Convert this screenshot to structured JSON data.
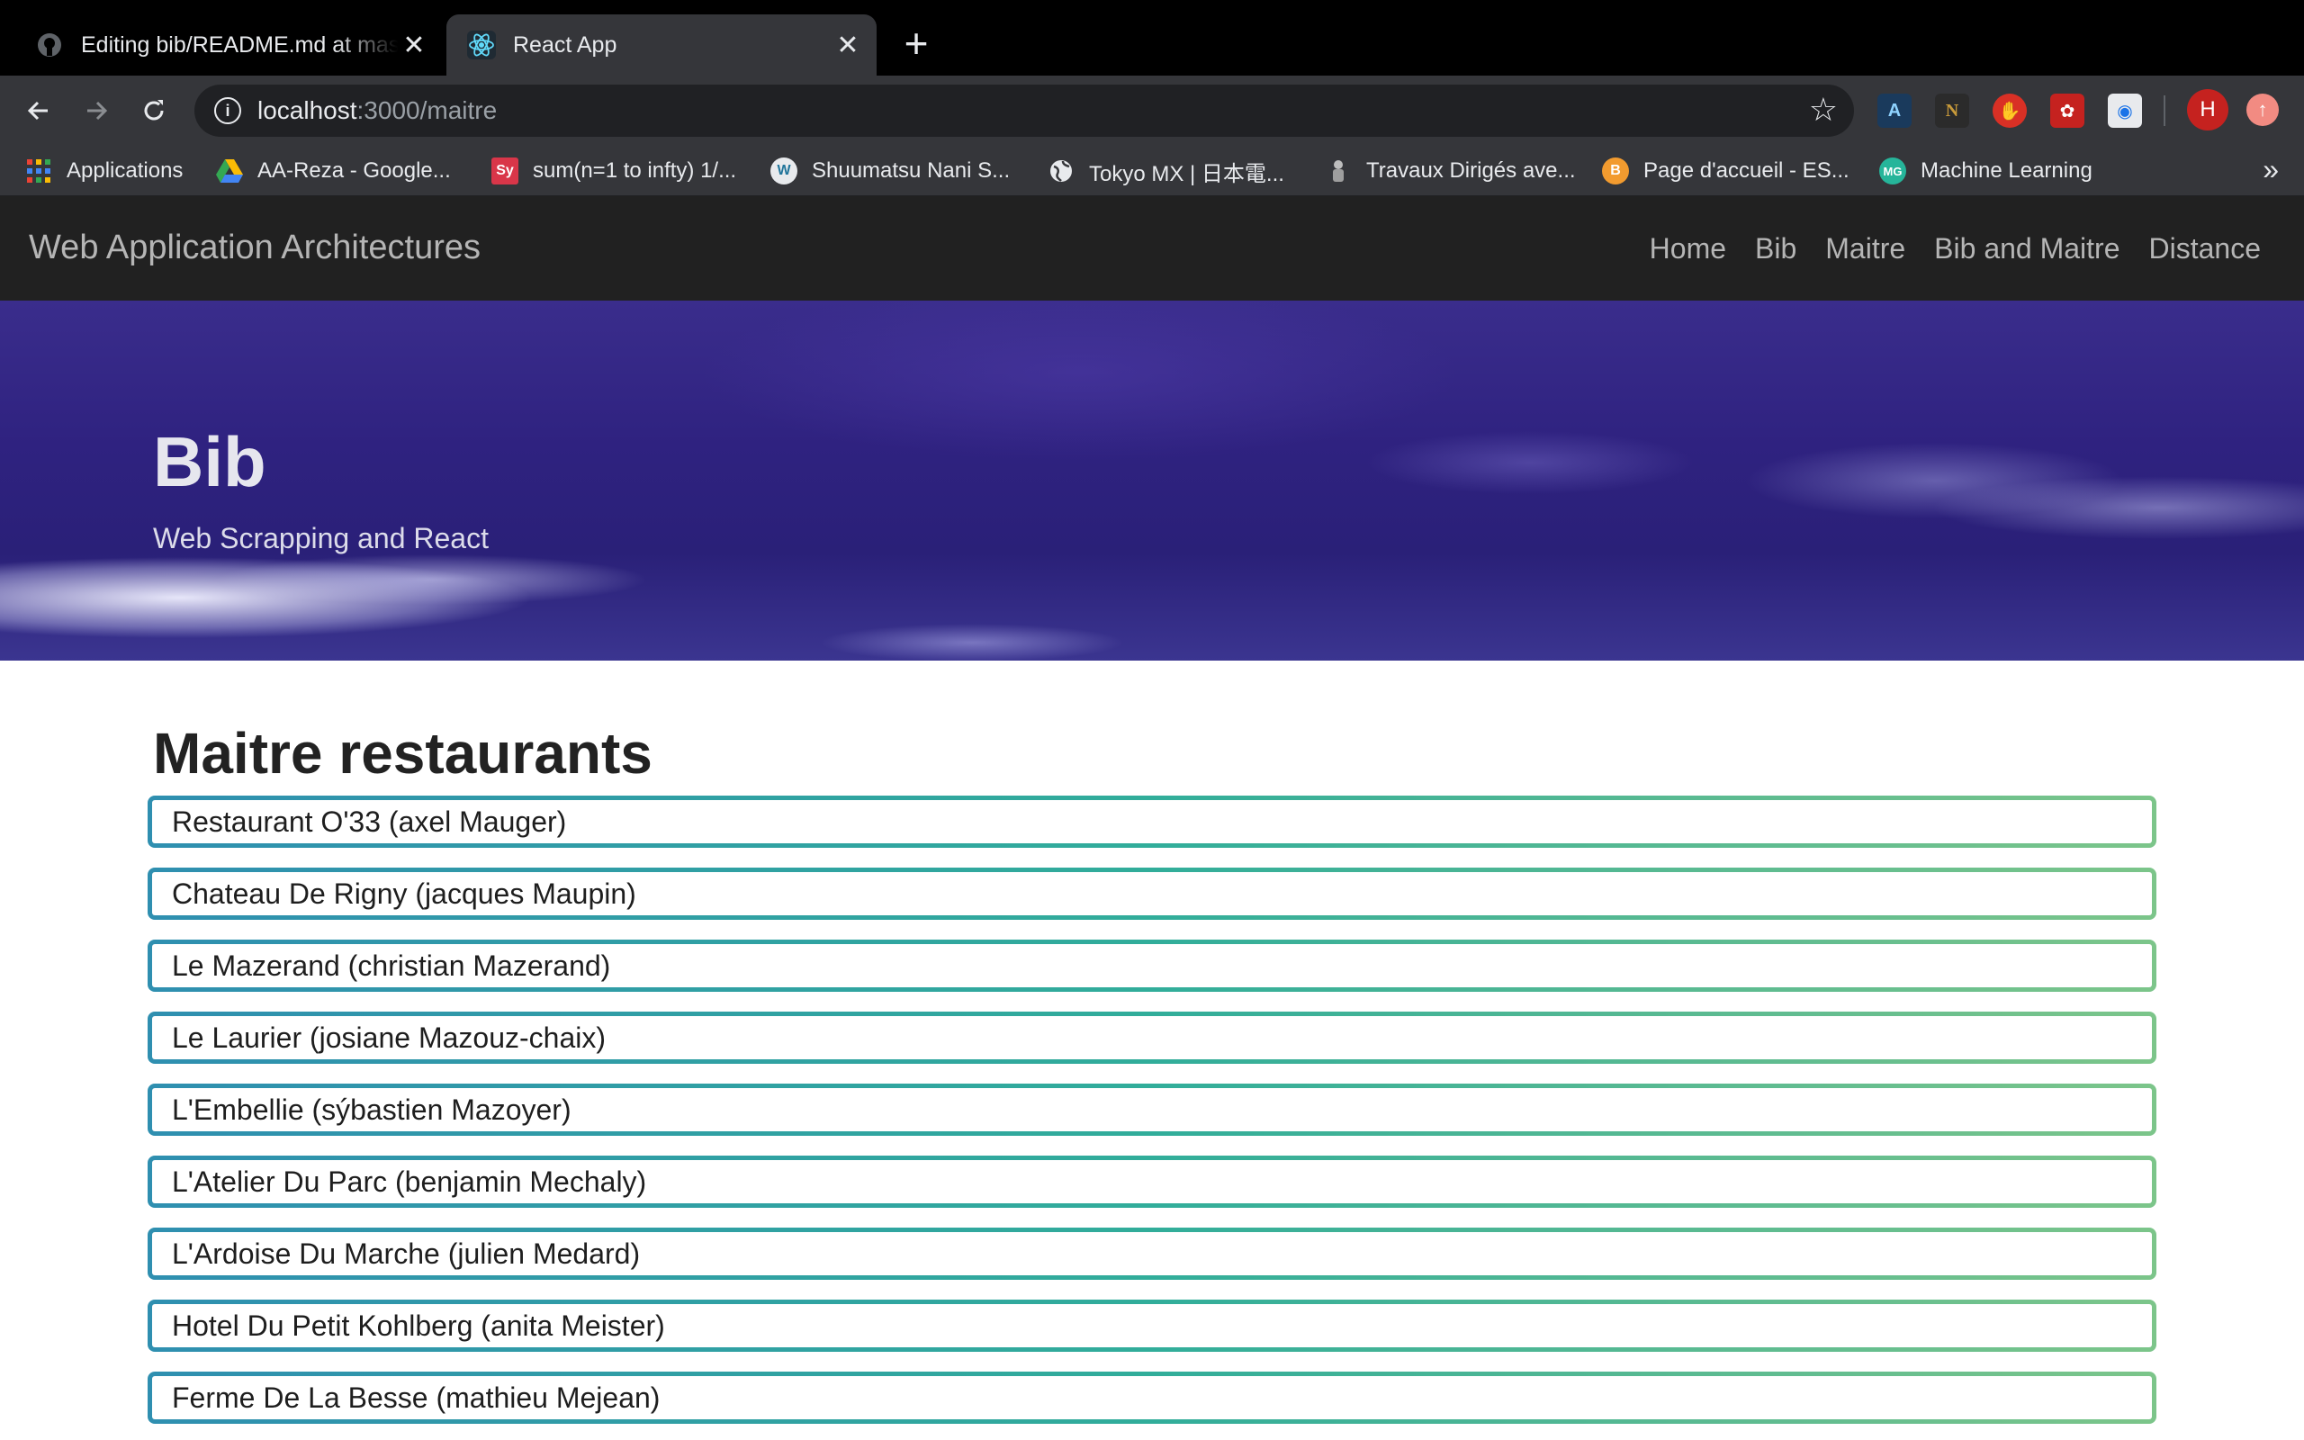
{
  "browser": {
    "tabs": [
      {
        "title": "Editing bib/README.md at master",
        "icon": "github-icon",
        "active": false
      },
      {
        "title": "React App",
        "icon": "react-icon",
        "active": true
      }
    ],
    "new_tab_label": "+",
    "close_label": "✕",
    "address": {
      "host": "localhost",
      "path": ":3000/maitre"
    },
    "profile_initial": "H",
    "bookmarks": [
      {
        "label": "Applications",
        "icon": "apps-grid-icon"
      },
      {
        "label": "AA-Reza - Google...",
        "icon": "google-drive-icon"
      },
      {
        "label": "sum(n=1 to infty) 1/...",
        "icon": "symbolab-icon",
        "icon_text": "Sy"
      },
      {
        "label": "Shuumatsu Nani S...",
        "icon": "wordpress-icon",
        "icon_text": "W"
      },
      {
        "label": "Tokyo MX | 日本電...",
        "icon": "globe-icon"
      },
      {
        "label": "Travaux Dirigés ave...",
        "icon": "doc-icon"
      },
      {
        "label": "Page d'accueil - ES...",
        "icon": "esilv-icon",
        "icon_text": "B"
      },
      {
        "label": "Machine Learning",
        "icon": "mg-icon",
        "icon_text": "MG"
      }
    ],
    "bookmarks_more": "»"
  },
  "navbar": {
    "brand": "Web Application Architectures",
    "links": [
      "Home",
      "Bib",
      "Maitre",
      "Bib and Maitre",
      "Distance"
    ]
  },
  "hero": {
    "title": "Bib",
    "subtitle": "Web Scrapping and React"
  },
  "main": {
    "heading": "Maitre restaurants",
    "restaurants": [
      "Restaurant O'33 (axel Mauger)",
      "Chateau De Rigny (jacques Maupin)",
      "Le Mazerand (christian Mazerand)",
      "Le Laurier (josiane Mazouz-chaix)",
      "L'Embellie (sýbastien Mazoyer)",
      "L'Atelier Du Parc (benjamin Mechaly)",
      "L'Ardoise Du Marche (julien Medard)",
      "Hotel Du Petit Kohlberg (anita Meister)",
      "Ferme De La Besse (mathieu Mejean)"
    ]
  },
  "colors": {
    "navbar_bg": "#212121",
    "hero_bg": "#2f2280",
    "item_border_start": "#2f8fb0",
    "item_border_end": "#7cc58a"
  }
}
